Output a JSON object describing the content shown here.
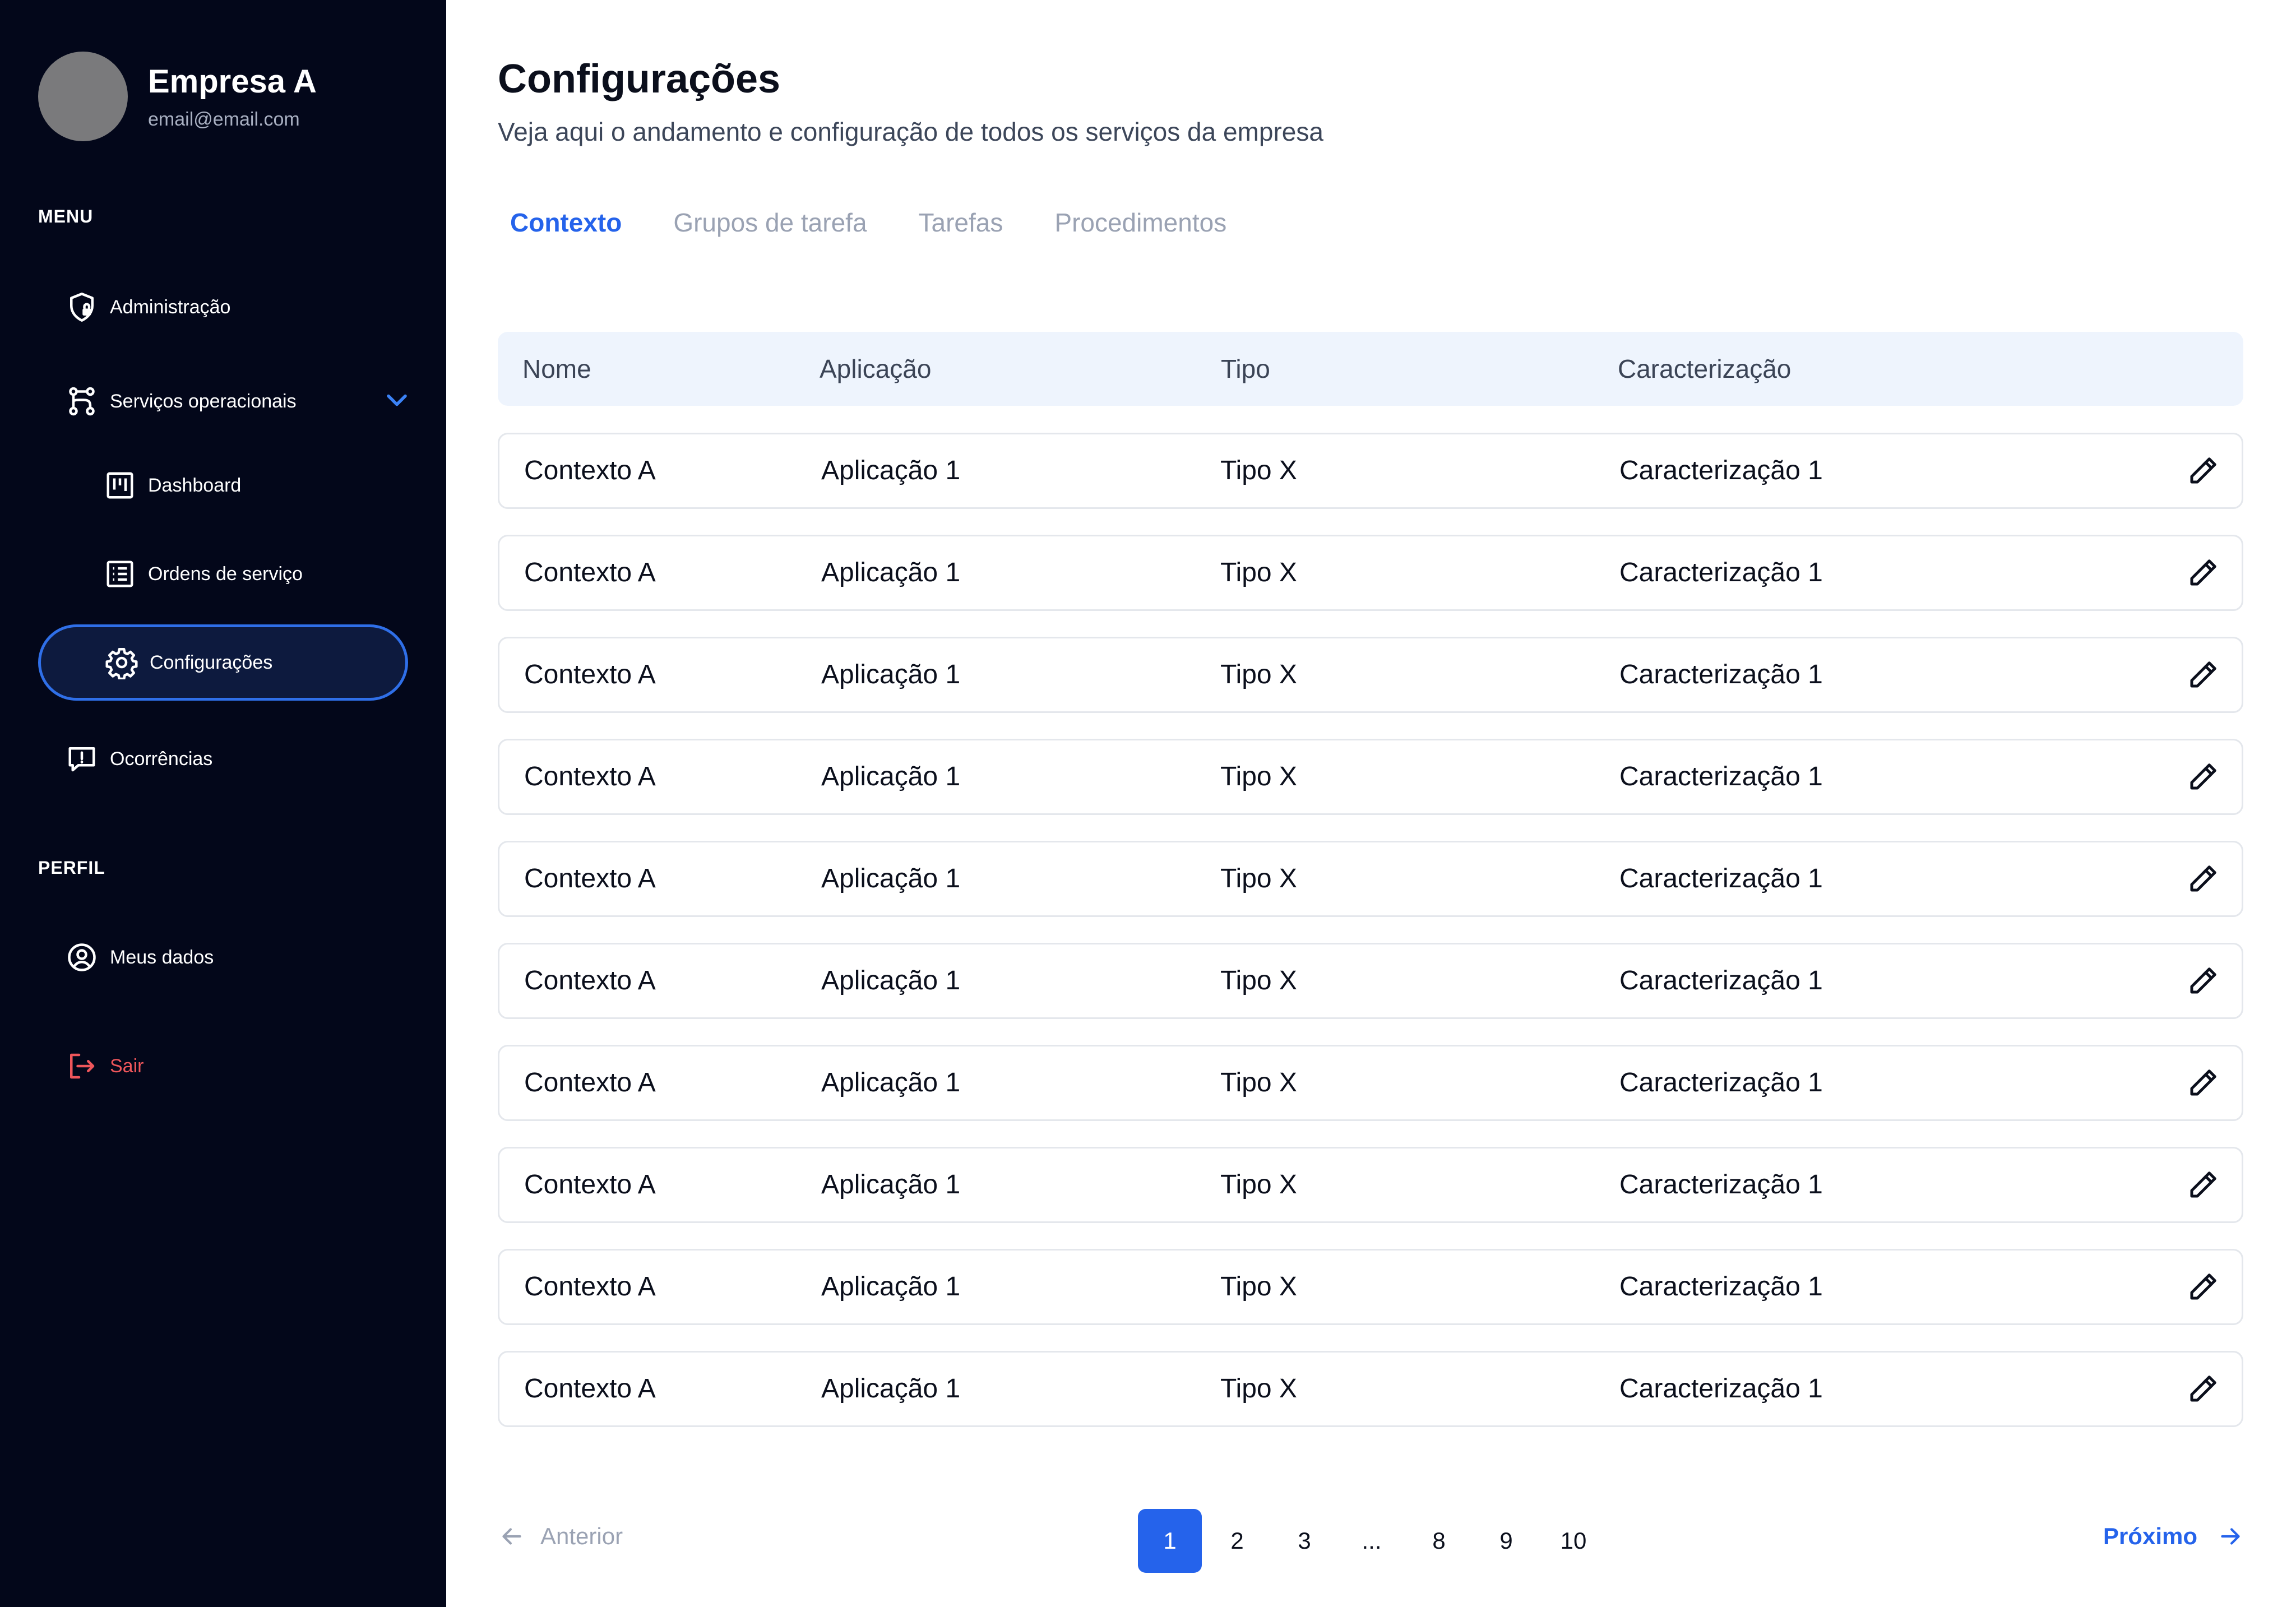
{
  "sidebar": {
    "company_name": "Empresa A",
    "company_email": "email@email.com",
    "menu_label": "MENU",
    "profile_label": "PERFIL",
    "items": {
      "administracao": "Administração",
      "servicos": "Serviços operacionais",
      "dashboard": "Dashboard",
      "ordens": "Ordens de serviço",
      "configuracoes": "Configurações",
      "ocorrencias": "Ocorrências",
      "meus_dados": "Meus dados",
      "sair": "Sair"
    },
    "active_item": "configuracoes"
  },
  "main": {
    "title": "Configurações",
    "subtitle": "Veja aqui o andamento e configuração de todos os serviços da empresa",
    "tabs": [
      "Contexto",
      "Grupos de tarefa",
      "Tarefas",
      "Procedimentos"
    ],
    "active_tab": "Contexto",
    "columns": [
      "Nome",
      "Aplicação",
      "Tipo",
      "Caracterização"
    ],
    "rows": [
      [
        "Contexto A",
        "Aplicação 1",
        "Tipo X",
        "Caracterização 1"
      ],
      [
        "Contexto A",
        "Aplicação 1",
        "Tipo X",
        "Caracterização 1"
      ],
      [
        "Contexto A",
        "Aplicação 1",
        "Tipo X",
        "Caracterização 1"
      ],
      [
        "Contexto A",
        "Aplicação 1",
        "Tipo X",
        "Caracterização 1"
      ],
      [
        "Contexto A",
        "Aplicação 1",
        "Tipo X",
        "Caracterização 1"
      ],
      [
        "Contexto A",
        "Aplicação 1",
        "Tipo X",
        "Caracterização 1"
      ],
      [
        "Contexto A",
        "Aplicação 1",
        "Tipo X",
        "Caracterização 1"
      ],
      [
        "Contexto A",
        "Aplicação 1",
        "Tipo X",
        "Caracterização 1"
      ],
      [
        "Contexto A",
        "Aplicação 1",
        "Tipo X",
        "Caracterização 1"
      ],
      [
        "Contexto A",
        "Aplicação 1",
        "Tipo X",
        "Caracterização 1"
      ]
    ]
  },
  "pagination": {
    "prev_label": "Anterior",
    "next_label": "Próximo",
    "pages": [
      "1",
      "2",
      "3",
      "...",
      "8",
      "9",
      "10"
    ],
    "current_page": "1"
  },
  "colors": {
    "sidebar_bg": "#03071a",
    "accent": "#2563eb",
    "logout": "#f0565b",
    "header_bg": "#eef4fd"
  },
  "icons": {
    "administracao": "shield-lock-icon",
    "servicos": "git-branch-icon",
    "dashboard": "kanban-board-icon",
    "ordens": "list-document-icon",
    "configuracoes": "gear-icon",
    "ocorrencias": "alert-message-icon",
    "meus_dados": "user-circle-icon",
    "sair": "logout-icon",
    "edit": "pencil-icon"
  }
}
